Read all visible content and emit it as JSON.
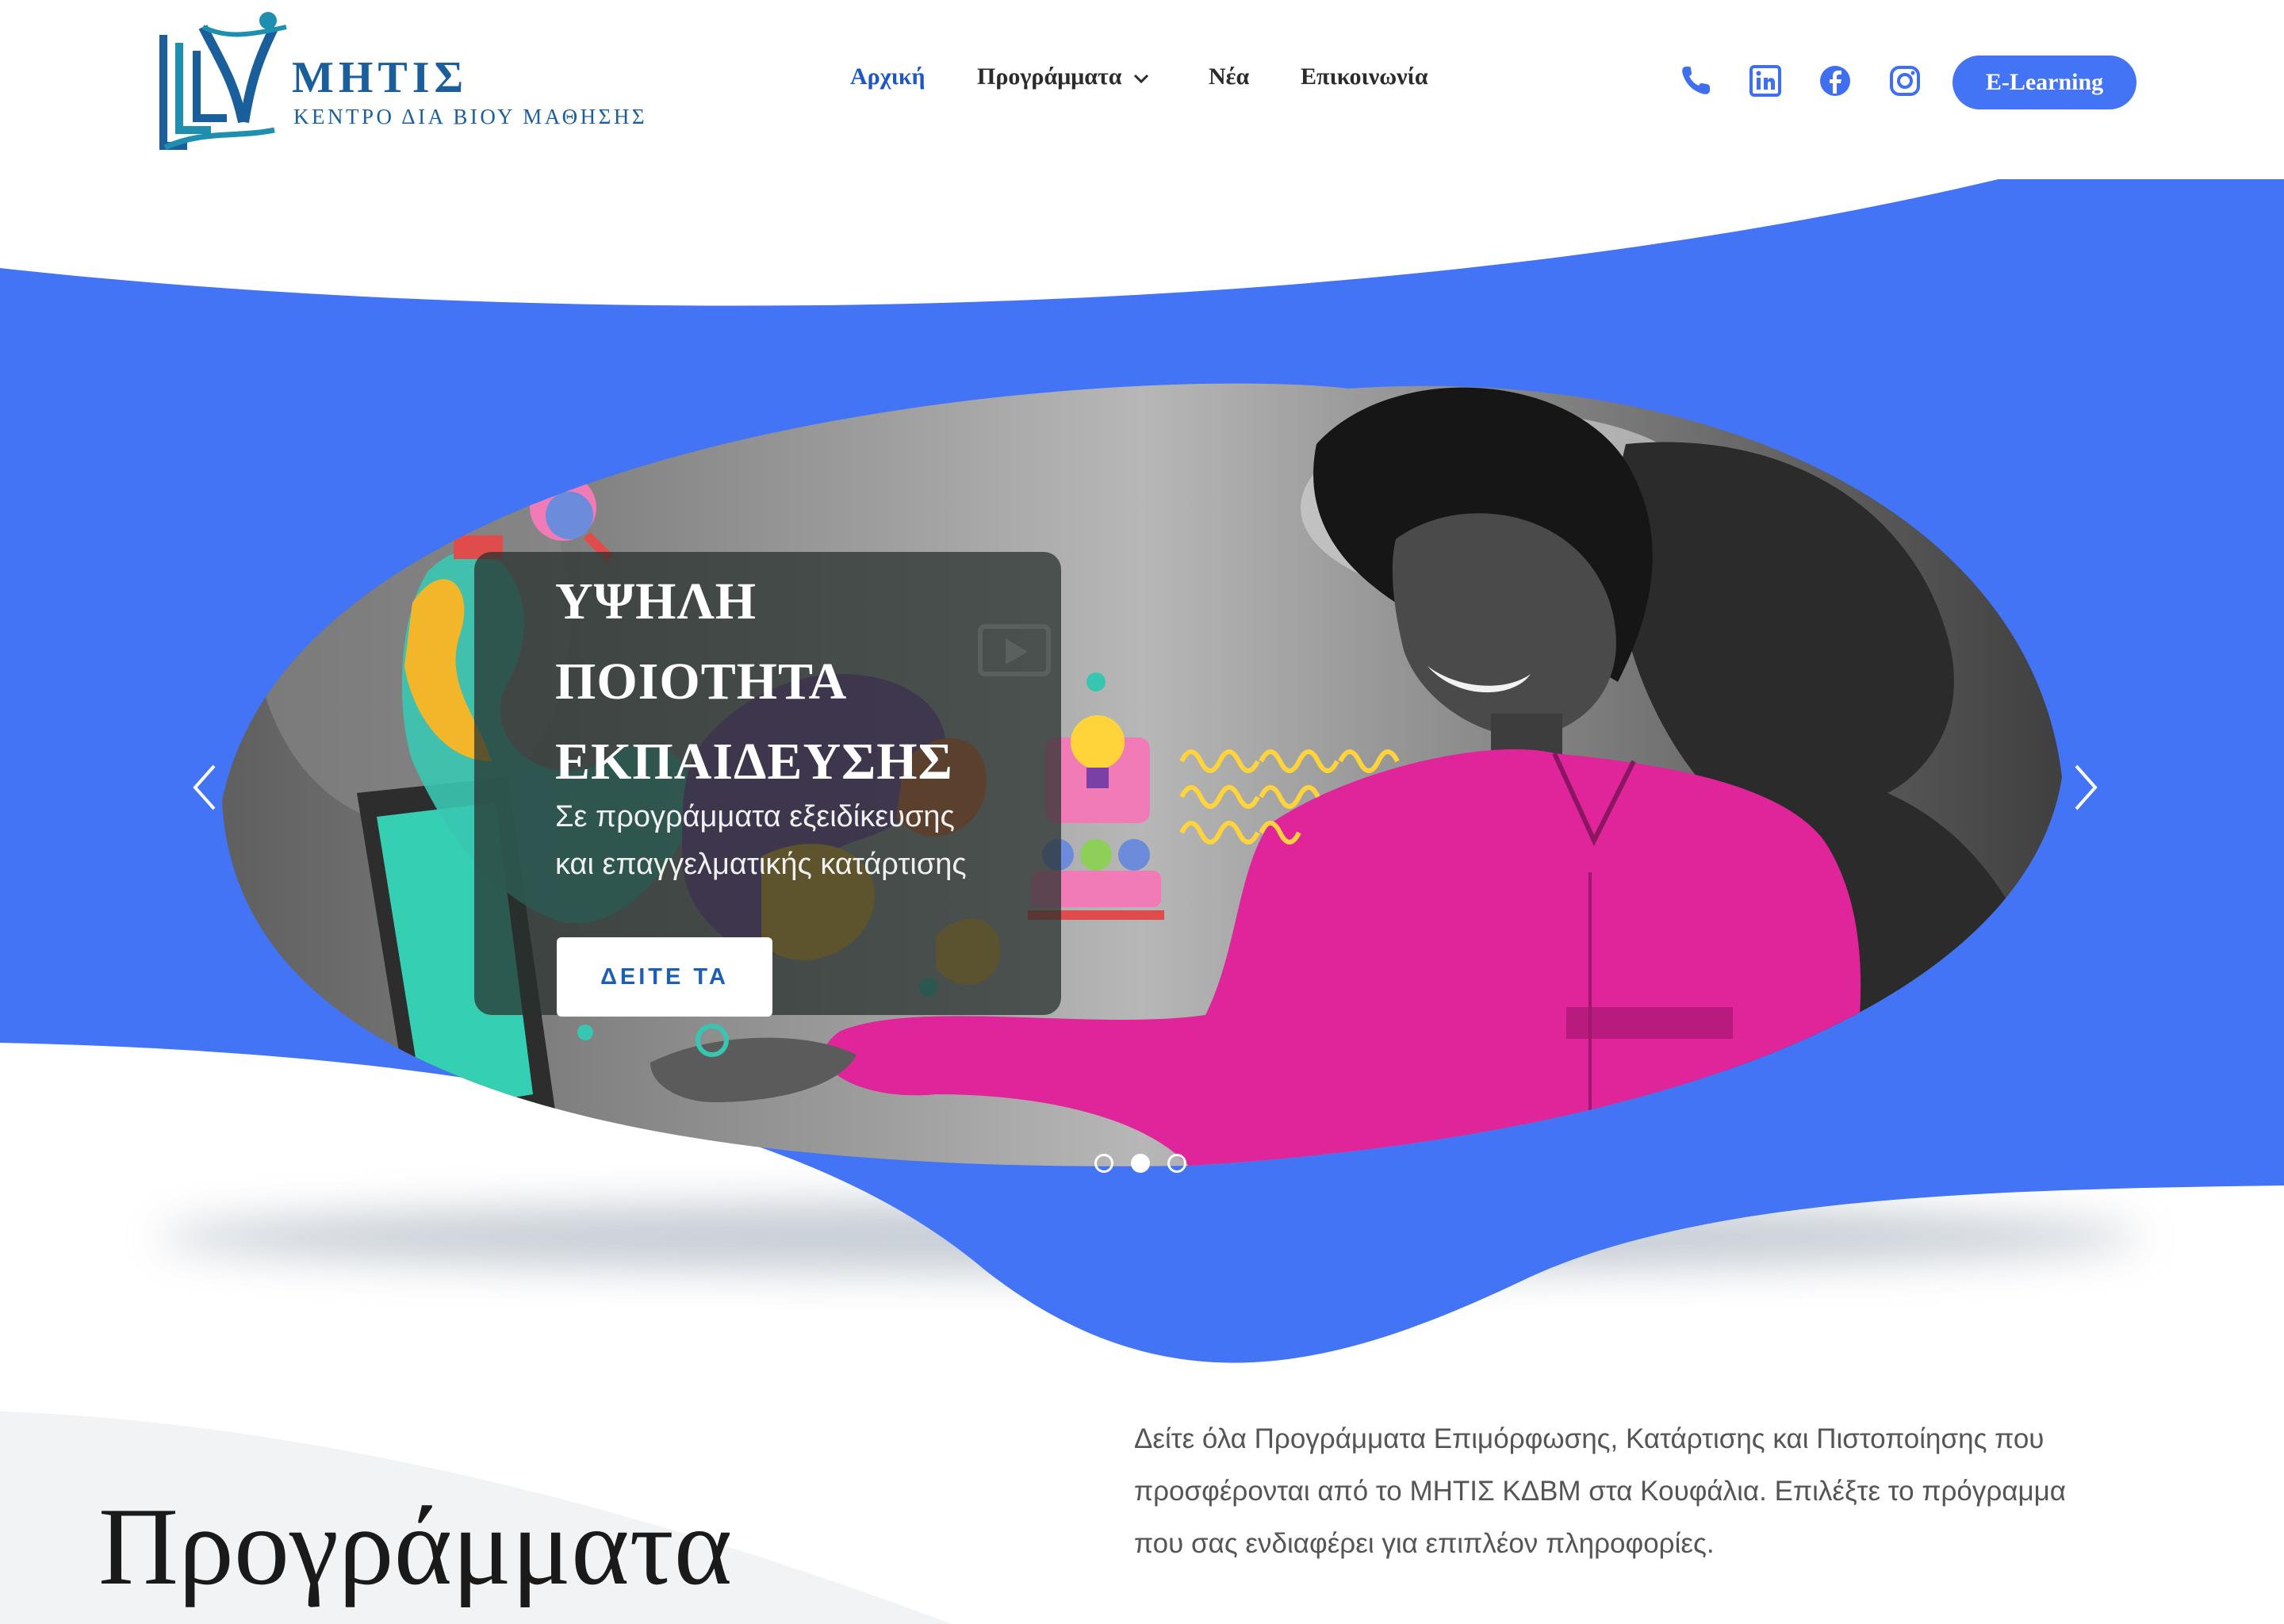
{
  "logo": {
    "title": "ΜΗΤΙΣ",
    "subtitle": "ΚΕΝΤΡΟ ΔΙΑ ΒΙΟΥ ΜΑΘΗΣΗΣ"
  },
  "nav": [
    {
      "label": "Αρχική",
      "active": true
    },
    {
      "label": "Προγράμματα",
      "has_dropdown": true
    },
    {
      "label": "Νέα"
    },
    {
      "label": "Επικοινωνία"
    }
  ],
  "social_icons": [
    "phone-icon",
    "linkedin-icon",
    "facebook-icon",
    "instagram-icon"
  ],
  "elearning_button": "E-Learning",
  "slider": {
    "title_lines": [
      "ΥΨΗΛΗ",
      "ΠΟΙΟΤΗΤΑ",
      "ΕΚΠΑΙΔΕΥΣΗΣ"
    ],
    "subtitle_lines": [
      "Σε προγράμματα εξειδίκευσης",
      "και επαγγελματικής κατάρτισης"
    ],
    "button": "ΔΕΙΤΕ ΤΑ",
    "slides_count": 3,
    "active_slide": 2
  },
  "section": {
    "title": "Προγράμματα",
    "description": "Δείτε όλα Προγράμματα Επιμόρφωσης, Κατάρτισης και Πιστοποίησης που προσφέρονται από το ΜΗΤΙΣ ΚΔΒΜ στα Κουφάλια. Επιλέξτε το πρόγραμμα που σας ενδιαφέρει για επιπλέον πληροφορίες."
  },
  "colors": {
    "brand_blue": "#4274f5",
    "nav_active": "#1e56c6",
    "logo_blue": "#1a5f9c",
    "accent_magenta": "#e0259a"
  }
}
